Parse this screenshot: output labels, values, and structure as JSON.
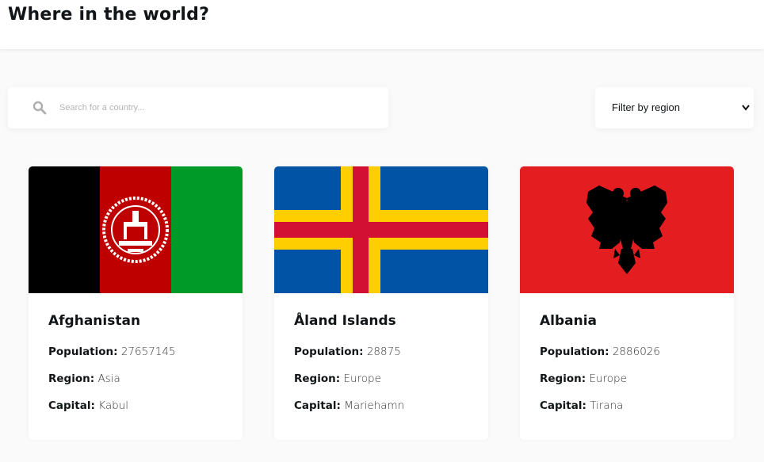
{
  "header": {
    "title": "Where in the world?"
  },
  "search": {
    "placeholder": "Search for a country...",
    "icon": "search-icon"
  },
  "filter": {
    "label": "Filter by region",
    "icon": "chevron-down-icon"
  },
  "labels": {
    "population": "Population:",
    "region": "Region:",
    "capital": "Capital:"
  },
  "countries": [
    {
      "name": "Afghanistan",
      "population": "27657145",
      "region": "Asia",
      "capital": "Kabul"
    },
    {
      "name": "Åland Islands",
      "population": "28875",
      "region": "Europe",
      "capital": "Mariehamn"
    },
    {
      "name": "Albania",
      "population": "2886026",
      "region": "Europe",
      "capital": "Tirana"
    }
  ],
  "colors": {
    "background": "#fafafa",
    "card": "#ffffff",
    "text": "#111517"
  }
}
